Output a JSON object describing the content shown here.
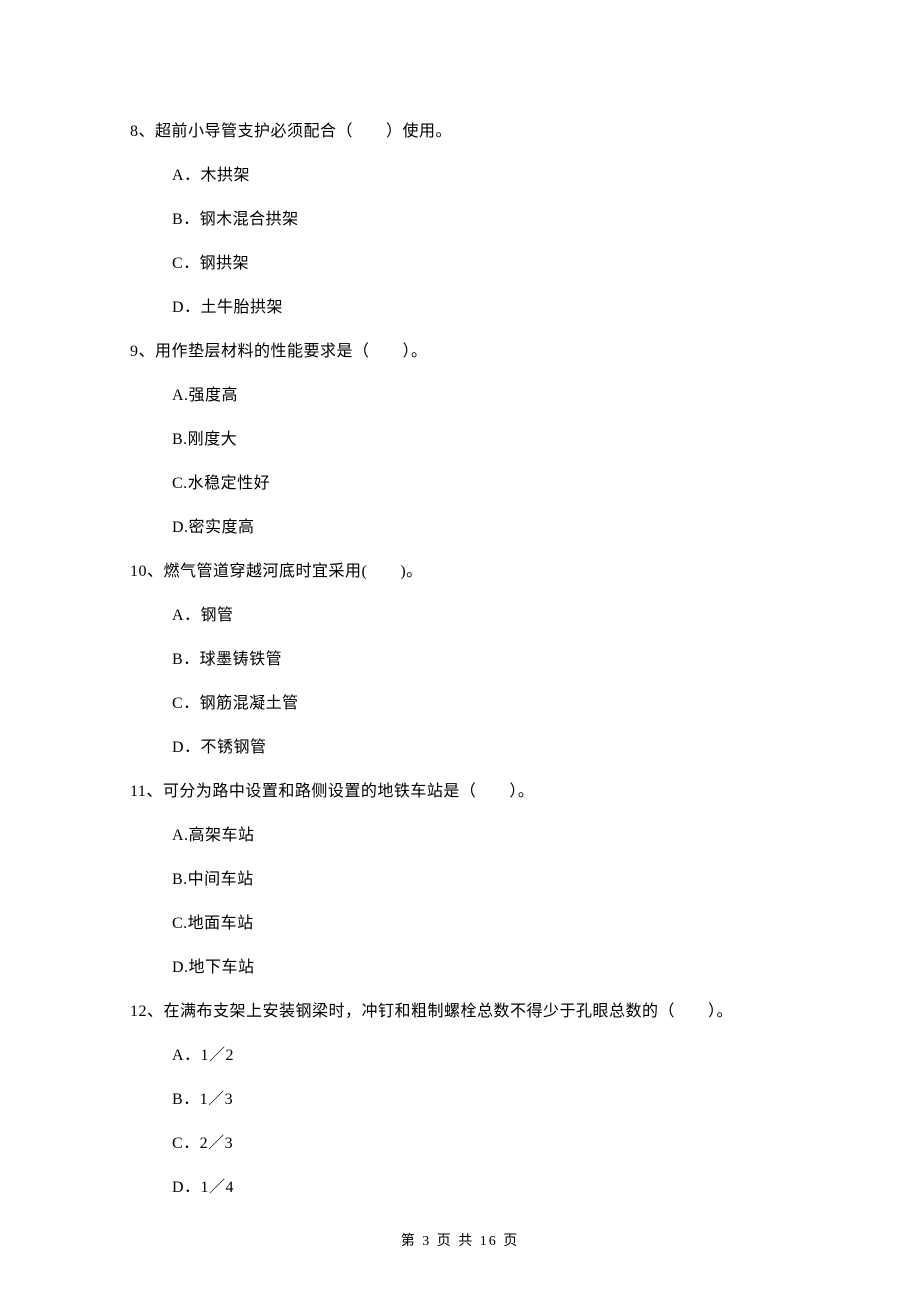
{
  "questions": [
    {
      "number": "8、",
      "stem": "超前小导管支护必须配合（　　）使用。",
      "options": [
        "A．木拱架",
        "B．钢木混合拱架",
        "C．钢拱架",
        "D．土牛胎拱架"
      ]
    },
    {
      "number": "9、",
      "stem": "用作垫层材料的性能要求是（　　）。",
      "options": [
        "A.强度高",
        "B.刚度大",
        "C.水稳定性好",
        "D.密实度高"
      ]
    },
    {
      "number": "10、",
      "stem": "燃气管道穿越河底时宜采用(　　)。",
      "options": [
        "A．钢管",
        "B．球墨铸铁管",
        "C．钢筋混凝土管",
        "D．不锈钢管"
      ]
    },
    {
      "number": "11、",
      "stem": "可分为路中设置和路侧设置的地铁车站是（　　）。",
      "options": [
        "A.高架车站",
        "B.中间车站",
        "C.地面车站",
        "D.地下车站"
      ]
    },
    {
      "number": "12、",
      "stem": "在满布支架上安装钢梁时，冲钉和粗制螺栓总数不得少于孔眼总数的（　　）。",
      "options": [
        "A．1／2",
        "B．1／3",
        "C．2／3",
        "D．1／4"
      ]
    }
  ],
  "footer": "第 3 页 共 16 页"
}
